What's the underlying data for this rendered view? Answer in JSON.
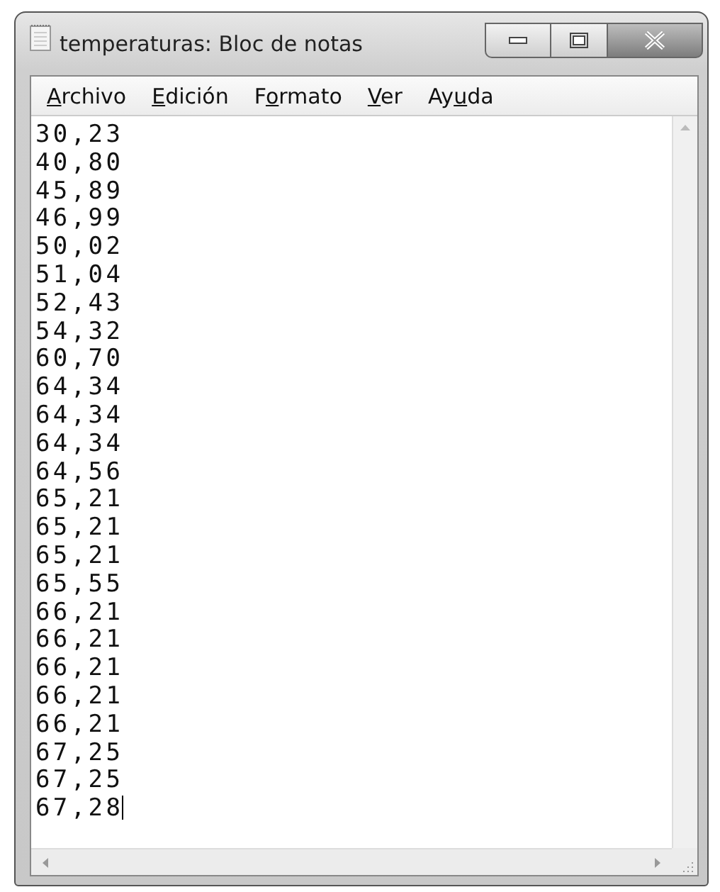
{
  "window": {
    "title": "temperaturas: Bloc de notas"
  },
  "menu": [
    {
      "key": "A",
      "post": "rchivo"
    },
    {
      "key": "E",
      "post": "dición"
    },
    {
      "pre": "F",
      "key": "o",
      "post": "rmato"
    },
    {
      "key": "V",
      "post": "er"
    },
    {
      "pre": "Ay",
      "key": "u",
      "post": "da"
    }
  ],
  "editor": {
    "caret_visible": true,
    "lines": [
      "30,23",
      "40,80",
      "45,89",
      "46,99",
      "50,02",
      "51,04",
      "52,43",
      "54,32",
      "60,70",
      "64,34",
      "64,34",
      "64,34",
      "64,56",
      "65,21",
      "65,21",
      "65,21",
      "65,55",
      "66,21",
      "66,21",
      "66,21",
      "66,21",
      "66,21",
      "67,25",
      "67,25",
      "67,28"
    ]
  }
}
